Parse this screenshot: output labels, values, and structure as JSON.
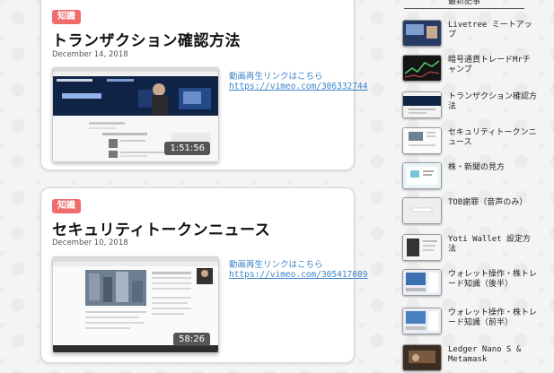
{
  "posts": [
    {
      "tag": "知識",
      "title": "トランザクション確認方法",
      "date": "December 14, 2018",
      "duration": "1:51:56",
      "link_label": "動画再生リンクはこちら",
      "link_url": "https://vimeo.com/306332744"
    },
    {
      "tag": "知識",
      "title": "セキュリティトークンニュース",
      "date": "December 10, 2018",
      "duration": "58:26",
      "link_label": "動画再生リンクはこちら",
      "link_url": "https://vimeo.com/305417089"
    }
  ],
  "sidebar": {
    "heading": "最新記事",
    "items": [
      {
        "title": "Livetree ミートアップ"
      },
      {
        "title": "暗号通貨トレードMrチャンプ"
      },
      {
        "title": "トランザクション確認方法"
      },
      {
        "title": "セキュリティトークンニュース"
      },
      {
        "title": "株・新聞の見方"
      },
      {
        "title": "TOB謝罪（音声のみ）"
      },
      {
        "title": "Yoti Wallet 設定方法"
      },
      {
        "title": "ウォレット操作・株トレード知識（後半）"
      },
      {
        "title": "ウォレット操作・株トレード知識（前半）"
      },
      {
        "title": "Ledger Nano S & Metamask"
      }
    ]
  },
  "colors": {
    "tag_bg": "#f06c6c",
    "link": "#3b84c8"
  }
}
